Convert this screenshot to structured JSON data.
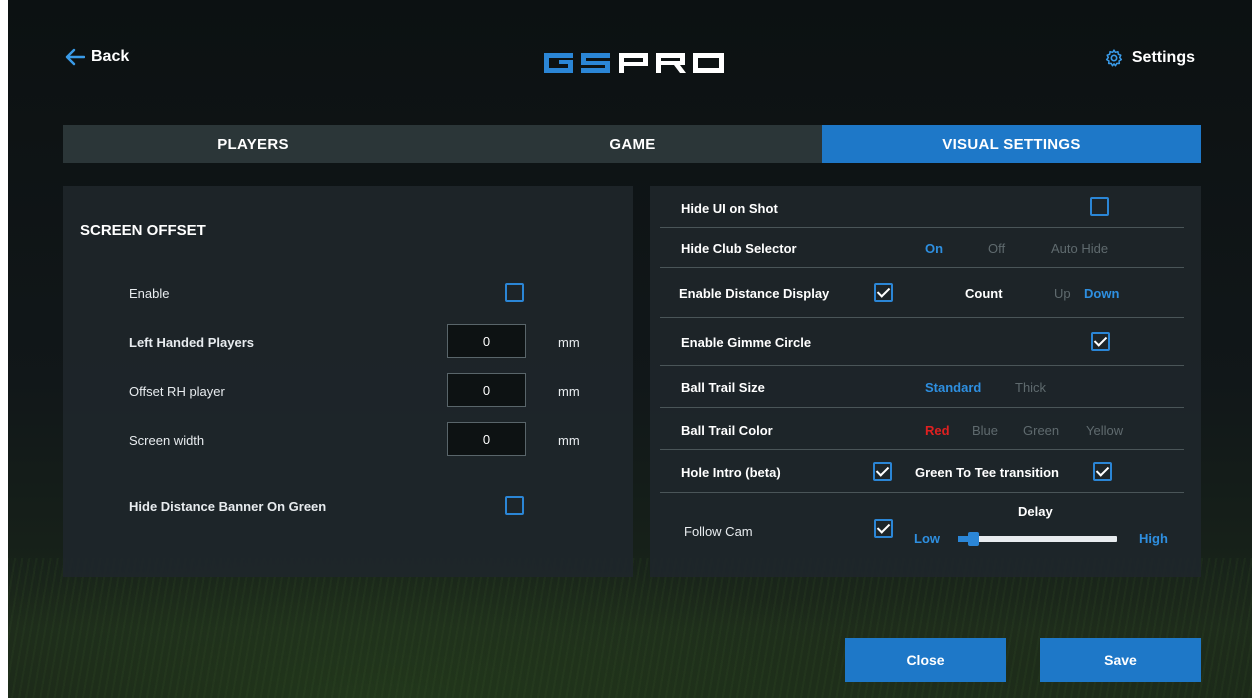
{
  "header": {
    "back_label": "Back",
    "logo_text": "GSPRO",
    "settings_label": "Settings"
  },
  "tabs": [
    {
      "label": "PLAYERS",
      "active": false
    },
    {
      "label": "GAME",
      "active": false
    },
    {
      "label": "VISUAL SETTINGS",
      "active": true
    }
  ],
  "screen_offset": {
    "title": "SCREEN OFFSET",
    "enable": {
      "label": "Enable",
      "checked": false
    },
    "left_handed": {
      "label": "Left Handed Players",
      "value": "0",
      "unit": "mm"
    },
    "offset_rh": {
      "label": "Offset RH player",
      "value": "0",
      "unit": "mm"
    },
    "screen_width": {
      "label": "Screen width",
      "value": "0",
      "unit": "mm"
    },
    "hide_banner": {
      "label": "Hide Distance Banner On Green",
      "checked": false
    }
  },
  "visual": {
    "hide_ui": {
      "label": "Hide UI on Shot",
      "checked": false
    },
    "hide_club": {
      "label": "Hide Club Selector",
      "options": [
        "On",
        "Off",
        "Auto Hide"
      ],
      "selected": "On"
    },
    "distance_display": {
      "label": "Enable Distance Display",
      "checked": true,
      "count_label": "Count",
      "options": [
        "Up",
        "Down"
      ],
      "selected": "Down"
    },
    "gimme": {
      "label": "Enable Gimme Circle",
      "checked": true
    },
    "trail_size": {
      "label": "Ball Trail Size",
      "options": [
        "Standard",
        "Thick"
      ],
      "selected": "Standard"
    },
    "trail_color": {
      "label": "Ball Trail Color",
      "options": [
        "Red",
        "Blue",
        "Green",
        "Yellow"
      ],
      "selected": "Red"
    },
    "hole_intro": {
      "label": "Hole Intro (beta)",
      "checked": true,
      "tee_label": "Green To Tee transition",
      "tee_checked": true
    },
    "follow_cam": {
      "label": "Follow Cam",
      "checked": true,
      "delay_label": "Delay",
      "low_label": "Low",
      "high_label": "High",
      "delay_level": 0.1
    }
  },
  "buttons": {
    "close": "Close",
    "save": "Save"
  },
  "colors": {
    "accent": "#1e78c8",
    "selected_option": "#2e8fe0",
    "red_option": "#e02020",
    "inactive_option": "#5f6a6e"
  }
}
